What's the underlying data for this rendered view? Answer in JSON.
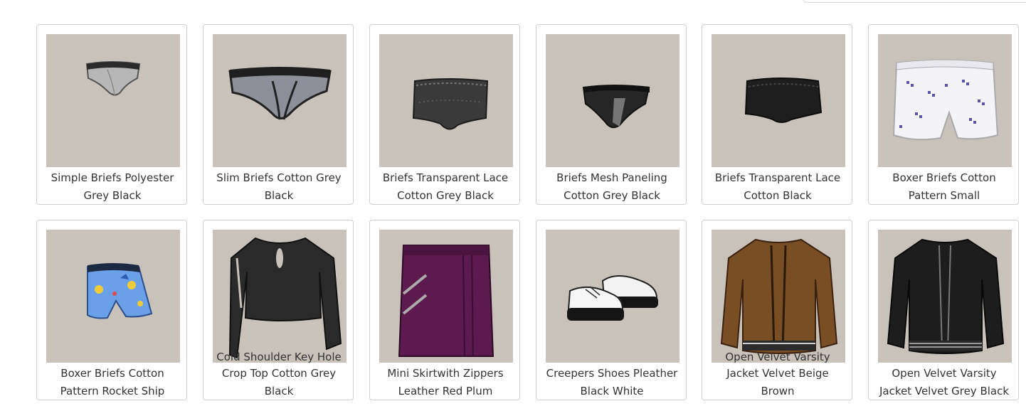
{
  "products": [
    {
      "line1": "Simple Briefs Polyester",
      "line2": "Grey Black",
      "icon": "briefs-grey-icon"
    },
    {
      "line1": "Slim Briefs Cotton Grey",
      "line2": "Black",
      "icon": "slim-briefs-icon"
    },
    {
      "line1": "Briefs Transparent Lace",
      "line2": "Cotton Grey Black",
      "icon": "lace-briefs-icon"
    },
    {
      "line1": "Briefs Mesh Paneling",
      "line2": "Cotton Grey Black",
      "icon": "mesh-briefs-icon"
    },
    {
      "line1": "Briefs Transparent Lace",
      "line2": "Cotton Black",
      "icon": "lace-briefs-black-icon"
    },
    {
      "line1": "Boxer Briefs Cotton",
      "line2": "Pattern Small",
      "icon": "boxer-briefs-pattern-icon"
    },
    {
      "line1": "Boxer Briefs Cotton",
      "line2": "Pattern Rocket Ship",
      "icon": "boxer-briefs-rocket-icon"
    },
    {
      "overlay": "Cold Shoulder Key Hole",
      "line1": "Crop Top Cotton Grey",
      "line2": "Black",
      "icon": "crop-top-icon"
    },
    {
      "line1": "Mini Skirtwith Zippers",
      "line2": "Leather Red Plum",
      "icon": "mini-skirt-icon"
    },
    {
      "line1": "Creepers Shoes Pleather",
      "line2": "Black White",
      "icon": "creepers-shoes-icon"
    },
    {
      "overlay": "Open Velvet Varsity",
      "line1": "Jacket Velvet Beige",
      "line2": "Brown",
      "icon": "varsity-jacket-brown-icon"
    },
    {
      "line1": "Open Velvet Varsity",
      "line2": "Jacket Velvet Grey Black",
      "icon": "varsity-jacket-black-icon"
    }
  ]
}
